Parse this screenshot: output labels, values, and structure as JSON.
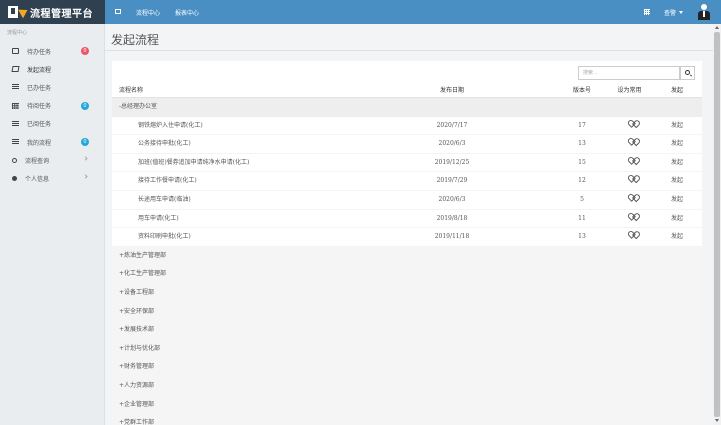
{
  "app": {
    "title": "流程管理平台"
  },
  "topnav": {
    "items": [
      "流程中心",
      "报表中心"
    ]
  },
  "user": {
    "name": "查警"
  },
  "sidebar": {
    "header": "流程中心",
    "items": [
      {
        "label": "待办任务",
        "icon": "inbox-icon",
        "badge": "0",
        "badge_color": "#ed5565"
      },
      {
        "label": "发起流程",
        "icon": "edit-icon"
      },
      {
        "label": "已办任务",
        "icon": "list-icon"
      },
      {
        "label": "待阅任务",
        "icon": "grid-icon",
        "badge": "0",
        "badge_color": "#23a6d8"
      },
      {
        "label": "已阅任务",
        "icon": "list-icon"
      },
      {
        "label": "我的流程",
        "icon": "list-icon",
        "badge": "0",
        "badge_color": "#23a6d8"
      },
      {
        "label": "流程查询",
        "icon": "search-icon"
      },
      {
        "label": "个人信息",
        "icon": "gear-icon"
      }
    ]
  },
  "page": {
    "title": "发起流程"
  },
  "search": {
    "placeholder": "搜索..."
  },
  "table": {
    "headers": {
      "name": "流程名称",
      "date": "发布日期",
      "version": "版本号",
      "favorite": "设为常用",
      "action": "发起"
    },
    "expanded_group": "-总经理办公室",
    "rows": [
      {
        "name": "钢铁熔炉入住申请(化工)",
        "date": "2020/7/17",
        "version": "17",
        "action": "发起"
      },
      {
        "name": "公务接待申批(化工)",
        "date": "2020/6/3",
        "version": "13",
        "action": "发起"
      },
      {
        "name": "加班(值班)餐券追加申请纯净水申请(化工)",
        "date": "2019/12/25",
        "version": "15",
        "action": "发起"
      },
      {
        "name": "接待工作餐申请(化工)",
        "date": "2019/7/29",
        "version": "12",
        "action": "发起"
      },
      {
        "name": "长途用车申请(临油)",
        "date": "2020/6/3",
        "version": "5",
        "action": "发起"
      },
      {
        "name": "用车申请(化工)",
        "date": "2019/8/18",
        "version": "11",
        "action": "发起"
      },
      {
        "name": "资料印刷申批(化工)",
        "date": "2019/11/18",
        "version": "13",
        "action": "发起"
      }
    ],
    "collapsed_groups": [
      "+炼油生产管理部",
      "+化工生产管理部",
      "+设备工程部",
      "+安全环保部",
      "+发展技术部",
      "+计划与优化部",
      "+财务管理部",
      "+人力资源部",
      "+企业管理部",
      "+党群工作部"
    ]
  },
  "colors": {
    "topbar": "#4a8fc4",
    "brand_bg": "#2f4050",
    "accent_red": "#ed5565",
    "accent_blue": "#23a6d8"
  }
}
